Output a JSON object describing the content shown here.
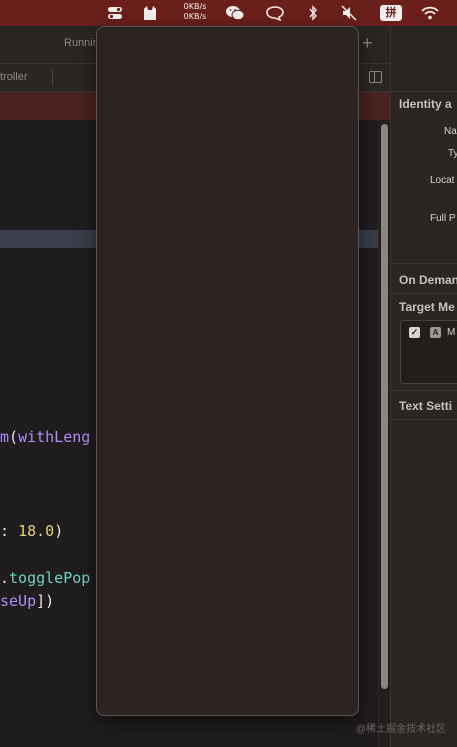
{
  "menubar": {
    "net_up": "0KB/s",
    "net_down": "0KB/s",
    "input_method": "拼",
    "icons": [
      "control-center-icon",
      "cat-app-icon",
      "wechat-icon",
      "chat-bubble-icon",
      "bluetooth-icon",
      "mute-icon",
      "input-method-icon",
      "wifi-icon"
    ]
  },
  "editor": {
    "tab_label": "Runnin",
    "jump_label": "troller",
    "code_lines": [
      {
        "parts": [
          "m",
          "(",
          "withLeng"
        ]
      },
      {
        "parts": [
          ": ",
          "18.0",
          ")"
        ]
      },
      {
        "parts": [
          ".",
          "togglePop"
        ]
      },
      {
        "parts": [
          "seUp",
          "])"
        ]
      }
    ]
  },
  "inspector": {
    "identity_heading": "Identity a",
    "name_label": "Na",
    "type_label": "Ty",
    "location_label": "Locat",
    "fullpath_label": "Full P",
    "on_demand_heading": "On Deman",
    "target_heading": "Target Me",
    "target_item": "M",
    "text_heading": "Text Setti"
  },
  "watermark": "@稀土掘金技术社区",
  "colors": {
    "menubar_bg": "#6b1f1a",
    "editor_bg": "#1f1c1d",
    "popover_bg": "#2b2421",
    "keyword_purple": "#b28cf7",
    "number_yellow": "#e8cf76",
    "method_teal": "#6fd3c8"
  }
}
